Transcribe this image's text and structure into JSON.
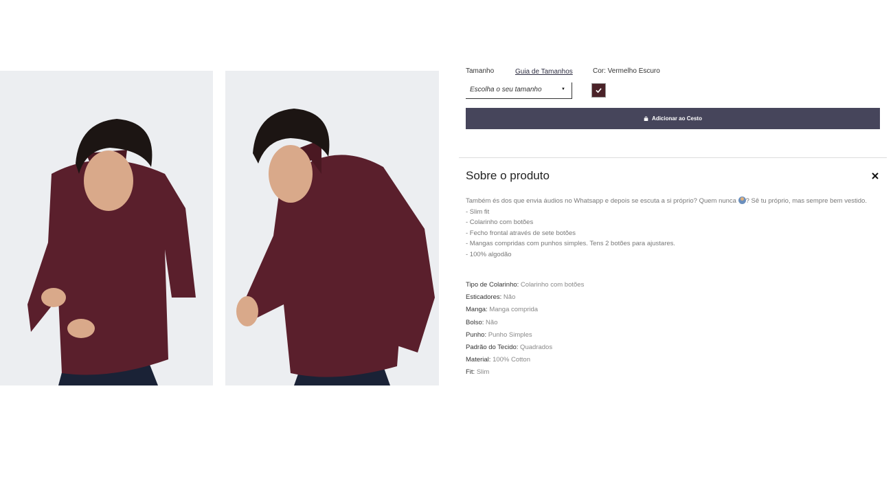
{
  "product": {
    "size_label": "Tamanho",
    "size_guide_link": "Guia de Tamanhos",
    "color_label": "Cor: Vermelho Escuro",
    "size_select_placeholder": "Escolha o seu tamanho",
    "color_swatch_hex": "#4a2228",
    "add_to_cart_label": "Adicionar ao Cesto",
    "button_color": "#46455b"
  },
  "about": {
    "title": "Sobre o produto",
    "intro_text_1": "Também és dos que envia áudios no Whatsapp e depois se escuta a si próprio? Quem nunca ",
    "intro_text_2": "? Sê tu próprio, mas sempre bem vestido.",
    "bullets": [
      "- Slim fit",
      "- Colarinho com botões",
      "- Fecho frontal através de sete botões",
      "- Mangas compridas com punhos simples. Tens 2 botões para ajustares.",
      "- 100% algodão"
    ],
    "specs": [
      {
        "label": "Tipo de Colarinho:",
        "value": " Colarinho com botões"
      },
      {
        "label": "Esticadores:",
        "value": " Não"
      },
      {
        "label": "Manga:",
        "value": " Manga comprida"
      },
      {
        "label": "Bolso:",
        "value": " Não"
      },
      {
        "label": "Punho:",
        "value": " Punho Simples"
      },
      {
        "label": "Padrão do Tecido:",
        "value": " Quadrados"
      },
      {
        "label": "Material:",
        "value": " 100% Cotton"
      },
      {
        "label": "Fit:",
        "value": " Slim"
      }
    ]
  },
  "icons": {
    "lock": "lock-icon",
    "check": "check-icon",
    "close": "close-icon",
    "caret": "caret-down-icon",
    "emoji": "person-emoji-icon"
  }
}
